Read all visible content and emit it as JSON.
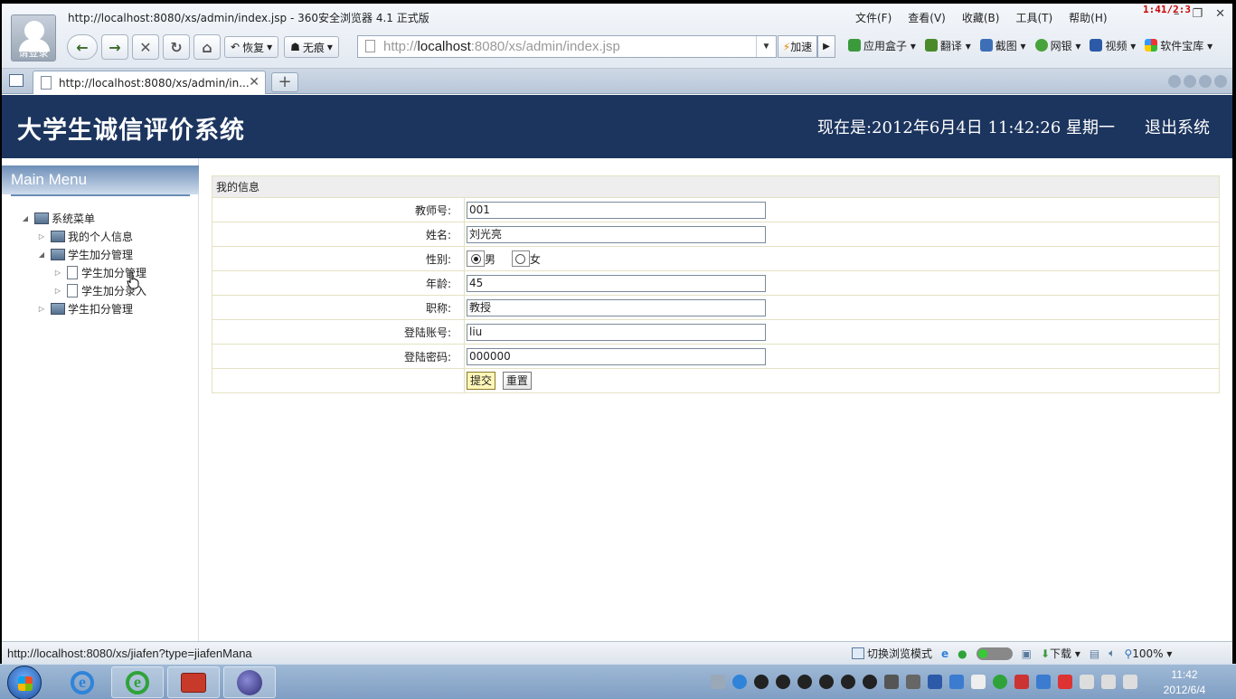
{
  "browser": {
    "window_title": "http://localhost:8080/xs/admin/index.jsp - 360安全浏览器 4.1 正式版",
    "login_label": "请登录",
    "overlay_time": "1:41/2:3",
    "menu": [
      "文件(F)",
      "查看(V)",
      "收藏(B)",
      "工具(T)",
      "帮助(H)"
    ],
    "nav": {
      "restore_label": "恢复",
      "incognito_label": "无痕"
    },
    "url_prefix": "http://",
    "url_host": "localhost",
    "url_rest": ":8080/xs/admin/index.jsp",
    "speedup_label": "加速",
    "tools": [
      "应用盒子",
      "翻译",
      "截图",
      "网银",
      "视频",
      "软件宝库"
    ],
    "tab_title": "http://localhost:8080/xs/admin/in...",
    "status_url": "http://localhost:8080/xs/jiafen?type=jiafenMana",
    "status_mode": "切换浏览模式",
    "status_download": "下载",
    "status_zoom": "100%"
  },
  "app": {
    "title": "大学生诚信评价系统",
    "datetime": "现在是:2012年6月4日  11:42:26 星期一",
    "logout": "退出系统"
  },
  "sidebar": {
    "heading": "Main Menu",
    "items": [
      {
        "label": "系统菜单",
        "type": "folder",
        "expanded": true
      },
      {
        "label": "我的个人信息",
        "type": "folder",
        "expanded": false
      },
      {
        "label": "学生加分管理",
        "type": "folder",
        "expanded": true
      },
      {
        "label": "学生加分管理",
        "type": "doc"
      },
      {
        "label": "学生加分录入",
        "type": "doc"
      },
      {
        "label": "学生扣分管理",
        "type": "folder",
        "expanded": false
      }
    ]
  },
  "form": {
    "caption": "我的信息",
    "teacher_id_label": "教师号:",
    "teacher_id": "001",
    "name_label": "姓名:",
    "name": "刘光亮",
    "gender_label": "性别:",
    "gender_male": "男",
    "gender_female": "女",
    "gender_selected": "男",
    "age_label": "年龄:",
    "age": "45",
    "title_label": "职称:",
    "title": "教授",
    "account_label": "登陆账号:",
    "account": "liu",
    "password_label": "登陆密码:",
    "password": "000000",
    "submit_label": "提交",
    "reset_label": "重置"
  },
  "taskbar": {
    "time": "11:42",
    "date": "2012/6/4"
  }
}
